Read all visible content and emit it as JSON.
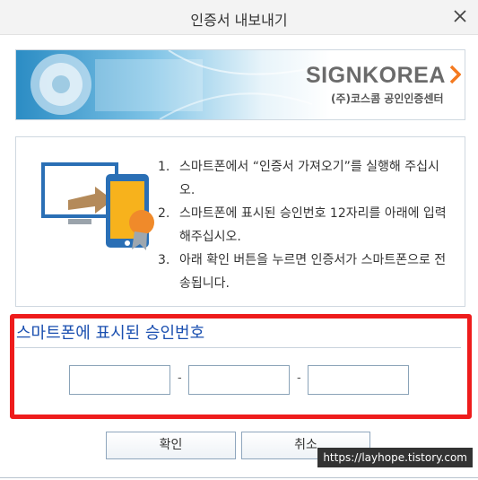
{
  "window": {
    "title": "인증서 내보내기"
  },
  "banner": {
    "brand": "SIGNKOREA",
    "subtitle": "(주)코스콤 공인인증센터"
  },
  "instructions": [
    {
      "num": "1.",
      "text": "스마트폰에서 “인증서 가져오기”를 실행해 주십시오."
    },
    {
      "num": "2.",
      "text": "스마트폰에 표시된 승인번호 12자리를 아래에 입력해주십시오."
    },
    {
      "num": "3.",
      "text": "아래 확인 버튼을 누르면 인증서가 스마트폰으로 전송됩니다."
    }
  ],
  "approval": {
    "label": "스마트폰에 표시된 승인번호",
    "inputs": [
      "",
      "",
      ""
    ],
    "separator": "-"
  },
  "buttons": {
    "confirm": "확인",
    "cancel": "취소"
  },
  "watermark": "https://layhope.tistory.com",
  "colors": {
    "highlight": "#ee1c1c",
    "label": "#1a4fb0"
  }
}
